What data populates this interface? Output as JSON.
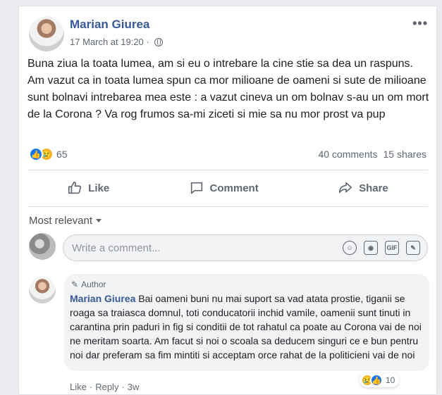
{
  "post": {
    "author": "Marian Giurea",
    "time": "17 March at 19:20 ·",
    "more": "•••",
    "text": "Buna ziua la toata lumea, am si eu o intrebare la cine stie sa dea un raspuns. Am vazut ca in toata lumea spun ca mor milioane de oameni si sute de milioane sunt bolnavi intrebarea mea este : a vazut cineva un om bolnav s-au un om mort de la Corona ? Va rog frumos sa-mi ziceti si mie sa nu mor prost va pup",
    "reaction_count": "65",
    "comments": "40 comments",
    "shares": "15 shares"
  },
  "actions": {
    "like": "Like",
    "comment": "Comment",
    "share": "Share"
  },
  "comments_section": {
    "sort": "Most relevant",
    "input_placeholder": "Write a comment...",
    "gif": "GIF"
  },
  "comment": {
    "tag": "Author",
    "author": "Marian Giurea",
    "text": "Bai oameni buni nu mai suport sa vad atata prostie, tiganii se roaga sa traiasca domnul, toti conducatorii inchid vamile, oamenii sunt tinuti in carantina prin paduri in fig si conditii de tot rahatul ca poate au Corona vai de noi ne meritam soarta. Am facut si noi o scoala sa deducem singuri ce e bun pentru noi dar preferam sa fim mintiti si acceptam orce rahat de la politicieni vai de noi",
    "reaction_count": "10",
    "like": "Like",
    "reply": "Reply",
    "time": "3w"
  },
  "colors": {
    "name": "#385898",
    "like_blue": "#1877f2",
    "sad_yellow": "#f7b125"
  },
  "icons": [
    "globe-icon",
    "like-icon",
    "comment-icon",
    "share-icon",
    "emoji-icon",
    "camera-icon",
    "gif-icon",
    "sticker-icon",
    "pencil-icon"
  ]
}
